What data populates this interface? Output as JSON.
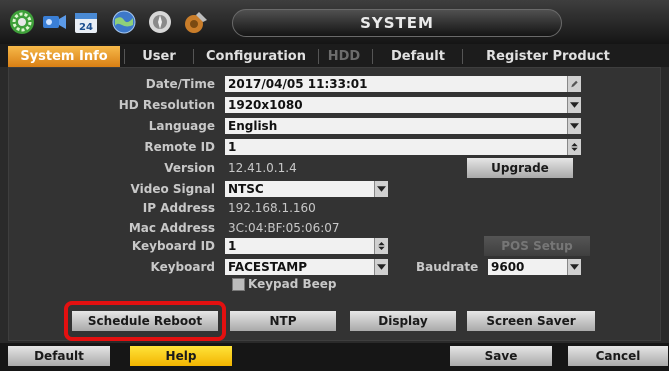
{
  "window": {
    "title": "SYSTEM"
  },
  "toolbar_icons": [
    "system-gear-icon",
    "camera-icon",
    "calendar-icon",
    "network-globe-icon",
    "event-icon",
    "storage-wrench-icon"
  ],
  "calendar_day": "24",
  "tabs": [
    {
      "label": "System Info",
      "state": "active"
    },
    {
      "label": "User",
      "state": "normal"
    },
    {
      "label": "Configuration",
      "state": "normal"
    },
    {
      "label": "HDD",
      "state": "disabled"
    },
    {
      "label": "Default",
      "state": "normal"
    },
    {
      "label": "Register Product",
      "state": "normal"
    }
  ],
  "form": {
    "date_time": {
      "label": "Date/Time",
      "value": "2017/04/05 11:33:01"
    },
    "hd_resolution": {
      "label": "HD Resolution",
      "value": "1920x1080"
    },
    "language": {
      "label": "Language",
      "value": "English"
    },
    "remote_id": {
      "label": "Remote ID",
      "value": "1"
    },
    "version": {
      "label": "Version",
      "value": "12.41.0.1.4"
    },
    "video_signal": {
      "label": "Video Signal",
      "value": "NTSC"
    },
    "ip_address": {
      "label": "IP Address",
      "value": "192.168.1.160"
    },
    "mac_address": {
      "label": "Mac Address",
      "value": "3C:04:BF:05:06:07"
    },
    "keyboard_id": {
      "label": "Keyboard ID",
      "value": "1"
    },
    "keyboard": {
      "label": "Keyboard",
      "value": "FACESTAMP"
    },
    "baudrate": {
      "label": "Baudrate",
      "value": "9600"
    },
    "keypad_beep": {
      "label": "Keypad Beep",
      "checked": false
    }
  },
  "buttons": {
    "upgrade": "Upgrade",
    "pos_setup": "POS Setup",
    "schedule_reboot": "Schedule Reboot",
    "ntp": "NTP",
    "display": "Display",
    "screen_saver": "Screen Saver",
    "default": "Default",
    "help": "Help",
    "save": "Save",
    "cancel": "Cancel"
  },
  "colors": {
    "active_tab": "#f0a030",
    "help_button": "#f7cf1a",
    "highlight_box": "#e31010"
  }
}
